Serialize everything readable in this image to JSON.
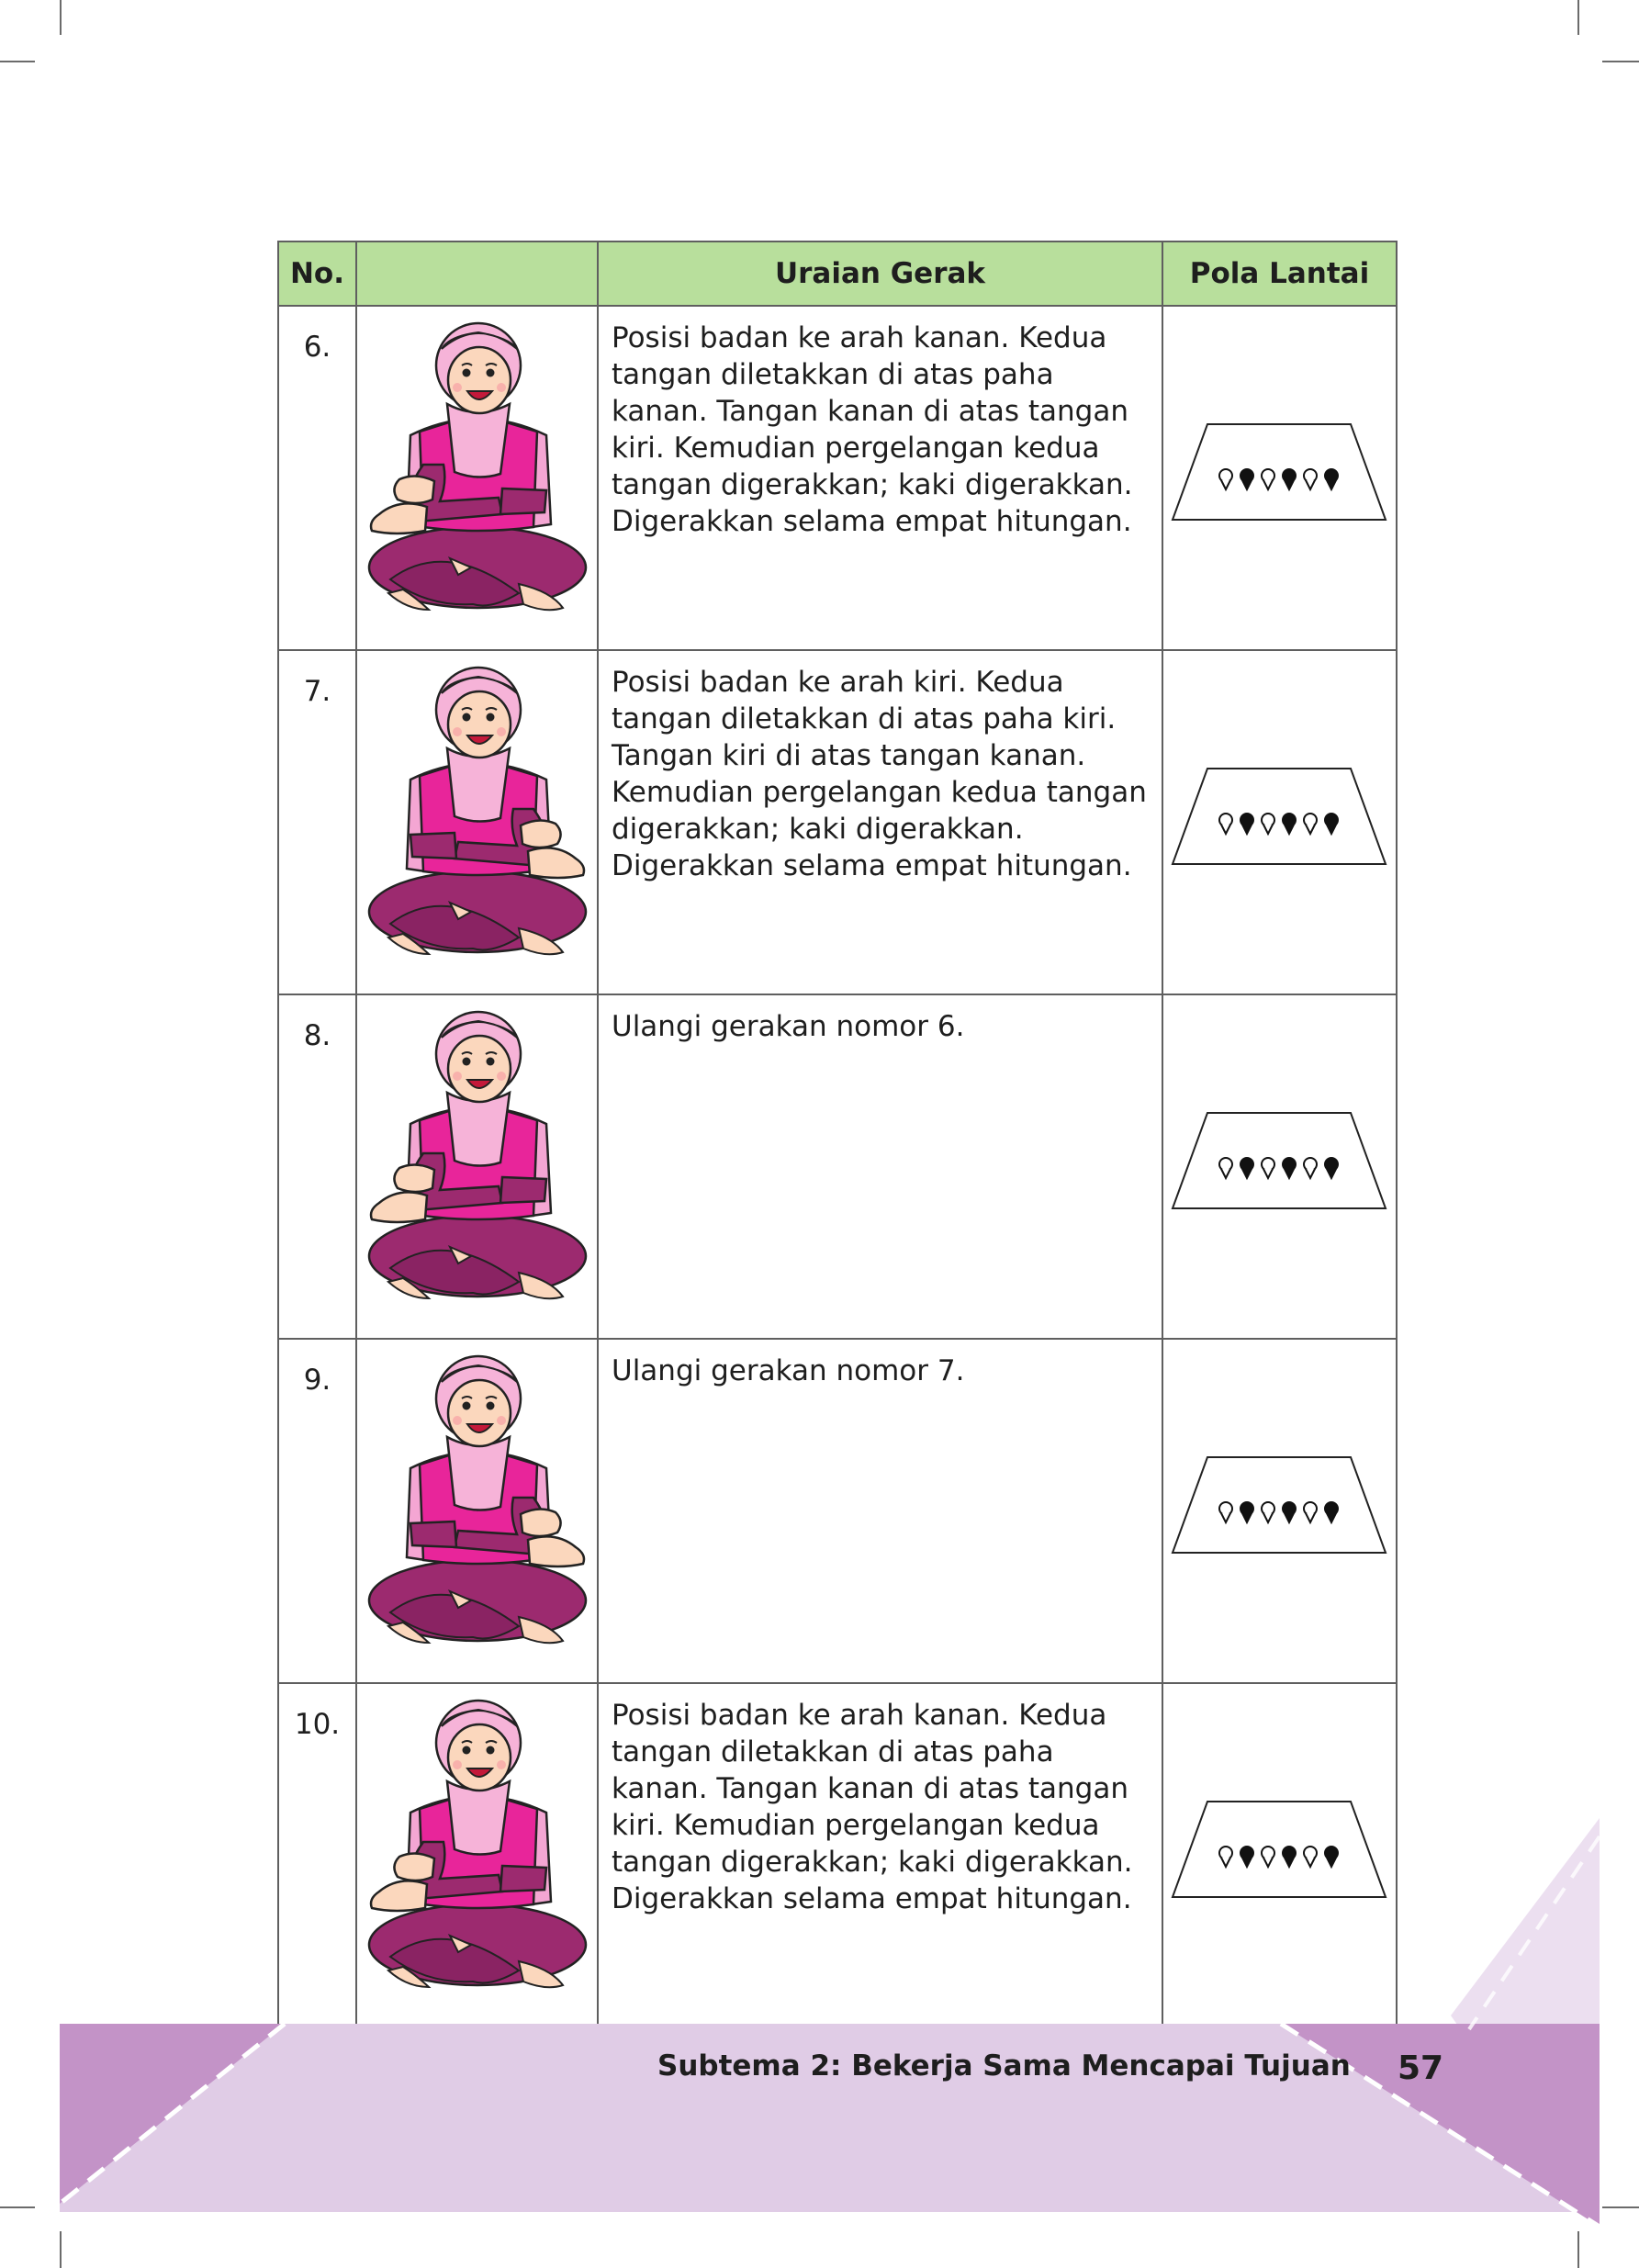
{
  "table": {
    "headers": [
      "No.",
      "",
      "Uraian Gerak",
      "Pola Lantai"
    ],
    "rows": [
      {
        "no": "6.",
        "pose": "hands-right",
        "desc": "Posisi badan ke arah kanan. Kedua tangan diletakkan di atas paha kanan. Tangan kanan di atas tangan kiri. Kemudian pergelangan kedua tangan digerakkan; kaki digerakkan. Digerakkan selama empat hitungan."
      },
      {
        "no": "7.",
        "pose": "hands-left",
        "desc": "Posisi badan ke arah kiri. Kedua tangan diletakkan di atas paha kiri. Tangan kiri di atas tangan kanan. Kemudian pergelangan kedua tangan digerakkan; kaki digerakkan. Digerakkan selama empat hitungan."
      },
      {
        "no": "8.",
        "pose": "hands-right",
        "desc": "Ulangi gerakan nomor 6."
      },
      {
        "no": "9.",
        "pose": "hands-left",
        "desc": "Ulangi gerakan nomor 7."
      },
      {
        "no": "10.",
        "pose": "hands-right",
        "desc": "Posisi badan ke arah kanan. Kedua tangan diletakkan di atas paha kanan. Tangan kanan di atas tangan kiri. Kemudian pergelangan kedua tangan digerakkan; kaki digerakkan. Digerakkan selama empat hitungan."
      }
    ]
  },
  "floor_pattern": {
    "dancers": [
      "open",
      "filled",
      "open",
      "filled",
      "open",
      "filled"
    ]
  },
  "footer": {
    "subtheme": "Subtema 2: Bekerja Sama Mencapai Tujuan",
    "page": "57"
  },
  "colors": {
    "header_bg": "#b8df9c",
    "footer_band": "#e0cce6",
    "footer_accent": "#c393c7",
    "vest": "#e8259a",
    "shirt": "#f4a6d3",
    "pants": "#9c2a6f"
  }
}
